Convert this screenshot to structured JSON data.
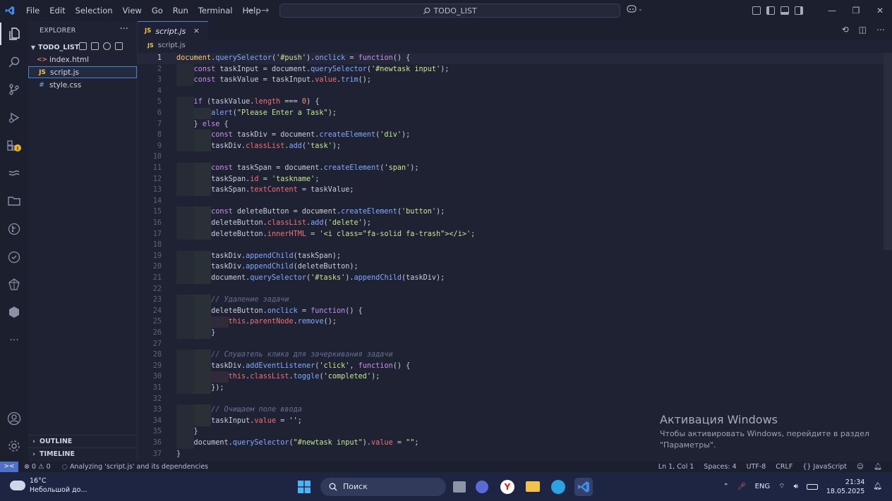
{
  "menu": [
    "File",
    "Edit",
    "Selection",
    "View",
    "Go",
    "Run",
    "Terminal",
    "Help"
  ],
  "search": {
    "text": "TODO_LIST"
  },
  "sidebar": {
    "title": "EXPLORER",
    "more": "···",
    "folder": "TODO_LIST",
    "files": [
      {
        "icon": "<>",
        "name": "index.html",
        "color": "#e57a54"
      },
      {
        "icon": "JS",
        "name": "script.js",
        "color": "#e8c84a"
      },
      {
        "icon": "#",
        "name": "style.css",
        "color": "#5a9be0"
      }
    ],
    "outline": "OUTLINE",
    "timeline": "TIMELINE"
  },
  "editor": {
    "tab": {
      "badge": "JS",
      "label": "script.js",
      "close": "×"
    },
    "breadcrumb": {
      "badge": "JS",
      "label": "script.js"
    }
  },
  "code": [
    "<span class=\"y\">document</span>.<span class=\"f\">querySelector</span>(<span class=\"s\">'#push'</span>).<span class=\"f\">onclick</span> = <span class=\"k\">function</span>() {",
    "    <span class=\"k\">const</span> taskInput = document.<span class=\"f\">querySelector</span>(<span class=\"s\">'#newtask input'</span>);",
    "    <span class=\"k\">const</span> taskValue = taskInput.<span class=\"t\">value</span>.<span class=\"f\">trim</span>();",
    "",
    "    <span class=\"k\">if</span> (taskValue.<span class=\"t\">length</span> === <span class=\"n\">0</span>) {",
    "        <span class=\"f\">alert</span>(<span class=\"s\">\"Please Enter a Task\"</span>);",
    "    } <span class=\"k\">else</span> {",
    "        <span class=\"k\">const</span> taskDiv = document.<span class=\"f\">createElement</span>(<span class=\"s\">'div'</span>);",
    "        taskDiv.<span class=\"t\">classList</span>.<span class=\"f\">add</span>(<span class=\"s\">'task'</span>);",
    "",
    "        <span class=\"k\">const</span> taskSpan = document.<span class=\"f\">createElement</span>(<span class=\"s\">'span'</span>);",
    "        taskSpan.<span class=\"t\">id</span> = <span class=\"s\">'taskname'</span>;",
    "        taskSpan.<span class=\"t\">textContent</span> = taskValue;",
    "",
    "        <span class=\"k\">const</span> deleteButton = document.<span class=\"f\">createElement</span>(<span class=\"s\">'button'</span>);",
    "        deleteButton.<span class=\"t\">classList</span>.<span class=\"f\">add</span>(<span class=\"s\">'delete'</span>);",
    "        deleteButton.<span class=\"t\">innerHTML</span> = <span class=\"s\">'&lt;i class=\"fa-solid fa-trash\"&gt;&lt;/i&gt;'</span>;",
    "",
    "        taskDiv.<span class=\"f\">appendChild</span>(taskSpan);",
    "        taskDiv.<span class=\"f\">appendChild</span>(deleteButton);",
    "        document.<span class=\"f\">querySelector</span>(<span class=\"s\">'#tasks'</span>).<span class=\"f\">appendChild</span>(taskDiv);",
    "",
    "        <span class=\"c\">// Удаление задачи</span>",
    "        deleteButton.<span class=\"f\">onclick</span> = <span class=\"k\">function</span>() {",
    "            <span class=\"t\">this</span>.<span class=\"t\">parentNode</span>.<span class=\"f\">remove</span>();",
    "        }",
    "",
    "        <span class=\"c\">// Слушатель клика для зачеркивания задачи</span>",
    "        taskDiv.<span class=\"f\">addEventListener</span>(<span class=\"s\">'click'</span>, <span class=\"k\">function</span>() {",
    "            <span class=\"t\">this</span>.<span class=\"t\">classList</span>.<span class=\"f\">toggle</span>(<span class=\"s\">'completed'</span>);",
    "        });",
    "",
    "        <span class=\"c\">// Очищаем поле ввода</span>",
    "        taskInput.<span class=\"t\">value</span> = <span class=\"s\">''</span>;",
    "    }",
    "    document.<span class=\"f\">querySelector</span>(<span class=\"s\">\"#newtask input\"</span>).<span class=\"t\">value</span> = <span class=\"s\">\"\"</span>;",
    "}"
  ],
  "watermark": {
    "title": "Активация Windows",
    "line1": "Чтобы активировать Windows, перейдите в раздел",
    "line2": "\"Параметры\"."
  },
  "status": {
    "remote": "><",
    "problems": "⊗ 0 ⚠ 0",
    "analyzing": "Analyzing 'script.js' and its dependencies",
    "position": "Ln 1, Col 1",
    "spaces": "Spaces: 4",
    "encoding": "UTF-8",
    "eol": "CRLF",
    "language": "{} JavaScript"
  },
  "taskbar": {
    "temp": "16°C",
    "weather": "Небольшой до...",
    "search": "Поиск",
    "lang": "ENG",
    "time": "21:34",
    "date": "18.05.2025"
  }
}
